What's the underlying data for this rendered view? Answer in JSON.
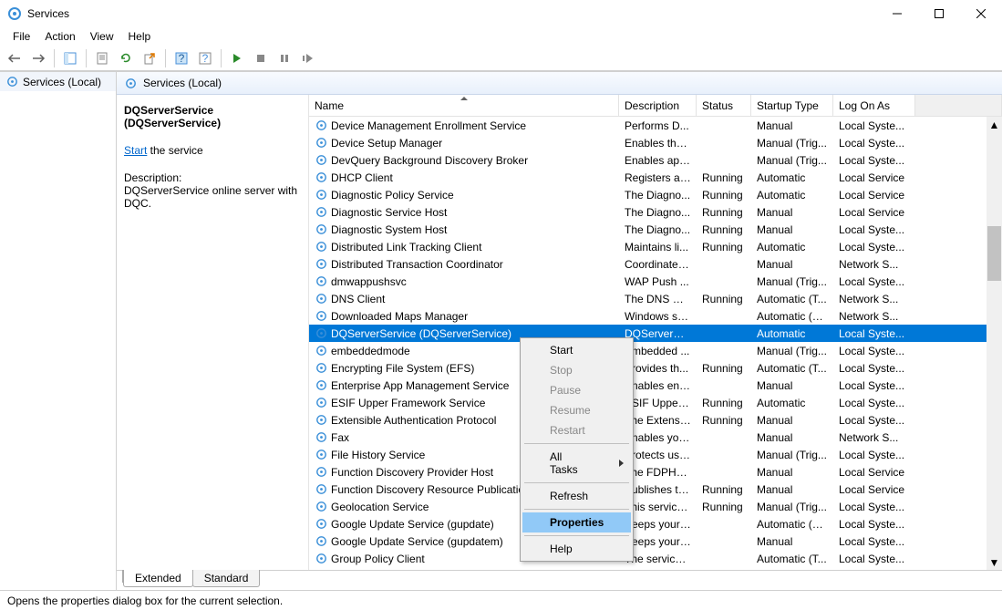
{
  "window": {
    "title": "Services"
  },
  "menu": {
    "file": "File",
    "action": "Action",
    "view": "View",
    "help": "Help"
  },
  "tree": {
    "root": "Services (Local)"
  },
  "pane_header": "Services (Local)",
  "details": {
    "name1": "DQServerService",
    "name2": "(DQServerService)",
    "start_link": "Start",
    "start_suffix": " the service",
    "desc_label": "Description:",
    "desc_text": "DQServerService online server with DQC."
  },
  "columns": {
    "name": "Name",
    "description": "Description",
    "status": "Status",
    "startup": "Startup Type",
    "logon": "Log On As"
  },
  "rows": [
    {
      "name": "Device Management Enrollment Service",
      "desc": "Performs D...",
      "status": "",
      "start": "Manual",
      "log": "Local Syste..."
    },
    {
      "name": "Device Setup Manager",
      "desc": "Enables the ...",
      "status": "",
      "start": "Manual (Trig...",
      "log": "Local Syste..."
    },
    {
      "name": "DevQuery Background Discovery Broker",
      "desc": "Enables app...",
      "status": "",
      "start": "Manual (Trig...",
      "log": "Local Syste..."
    },
    {
      "name": "DHCP Client",
      "desc": "Registers an...",
      "status": "Running",
      "start": "Automatic",
      "log": "Local Service"
    },
    {
      "name": "Diagnostic Policy Service",
      "desc": "The Diagno...",
      "status": "Running",
      "start": "Automatic",
      "log": "Local Service"
    },
    {
      "name": "Diagnostic Service Host",
      "desc": "The Diagno...",
      "status": "Running",
      "start": "Manual",
      "log": "Local Service"
    },
    {
      "name": "Diagnostic System Host",
      "desc": "The Diagno...",
      "status": "Running",
      "start": "Manual",
      "log": "Local Syste..."
    },
    {
      "name": "Distributed Link Tracking Client",
      "desc": "Maintains li...",
      "status": "Running",
      "start": "Automatic",
      "log": "Local Syste..."
    },
    {
      "name": "Distributed Transaction Coordinator",
      "desc": "Coordinates...",
      "status": "",
      "start": "Manual",
      "log": "Network S..."
    },
    {
      "name": "dmwappushsvc",
      "desc": "WAP Push ...",
      "status": "",
      "start": "Manual (Trig...",
      "log": "Local Syste..."
    },
    {
      "name": "DNS Client",
      "desc": "The DNS Cli...",
      "status": "Running",
      "start": "Automatic (T...",
      "log": "Network S..."
    },
    {
      "name": "Downloaded Maps Manager",
      "desc": "Windows se...",
      "status": "",
      "start": "Automatic (D...",
      "log": "Network S..."
    },
    {
      "name": "DQServerService (DQServerService)",
      "desc": "DQServerSe...",
      "status": "",
      "start": "Automatic",
      "log": "Local Syste...",
      "sel": true
    },
    {
      "name": "embeddedmode",
      "desc": "Embedded ...",
      "status": "",
      "start": "Manual (Trig...",
      "log": "Local Syste..."
    },
    {
      "name": "Encrypting File System (EFS)",
      "desc": "Provides th...",
      "status": "Running",
      "start": "Automatic (T...",
      "log": "Local Syste..."
    },
    {
      "name": "Enterprise App Management Service",
      "desc": "Enables ent...",
      "status": "",
      "start": "Manual",
      "log": "Local Syste..."
    },
    {
      "name": "ESIF Upper Framework Service",
      "desc": "ESIF Upper ...",
      "status": "Running",
      "start": "Automatic",
      "log": "Local Syste..."
    },
    {
      "name": "Extensible Authentication Protocol",
      "desc": "The Extensi...",
      "status": "Running",
      "start": "Manual",
      "log": "Local Syste..."
    },
    {
      "name": "Fax",
      "desc": "Enables you...",
      "status": "",
      "start": "Manual",
      "log": "Network S..."
    },
    {
      "name": "File History Service",
      "desc": "Protects use...",
      "status": "",
      "start": "Manual (Trig...",
      "log": "Local Syste..."
    },
    {
      "name": "Function Discovery Provider Host",
      "desc": "The FDPHO...",
      "status": "",
      "start": "Manual",
      "log": "Local Service"
    },
    {
      "name": "Function Discovery Resource Publication",
      "desc": "Publishes th...",
      "status": "Running",
      "start": "Manual",
      "log": "Local Service"
    },
    {
      "name": "Geolocation Service",
      "desc": "This service ...",
      "status": "Running",
      "start": "Manual (Trig...",
      "log": "Local Syste..."
    },
    {
      "name": "Google Update Service (gupdate)",
      "desc": "Keeps your ...",
      "status": "",
      "start": "Automatic (D...",
      "log": "Local Syste..."
    },
    {
      "name": "Google Update Service (gupdatem)",
      "desc": "Keeps your ...",
      "status": "",
      "start": "Manual",
      "log": "Local Syste..."
    },
    {
      "name": "Group Policy Client",
      "desc": "The service ...",
      "status": "",
      "start": "Automatic (T...",
      "log": "Local Syste..."
    }
  ],
  "ctx": {
    "start": "Start",
    "stop": "Stop",
    "pause": "Pause",
    "resume": "Resume",
    "restart": "Restart",
    "alltasks": "All Tasks",
    "refresh": "Refresh",
    "properties": "Properties",
    "help": "Help"
  },
  "tabs": {
    "extended": "Extended",
    "standard": "Standard"
  },
  "status": "Opens the properties dialog box for the current selection."
}
